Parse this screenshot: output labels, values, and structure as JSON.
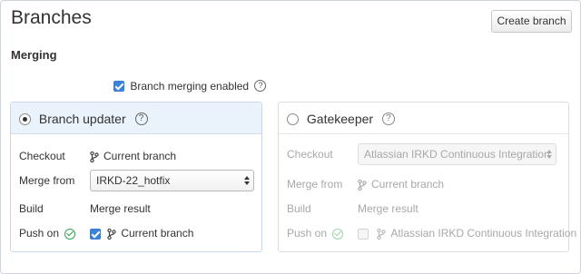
{
  "page": {
    "title": "Branches",
    "create_button": "Create branch"
  },
  "merging": {
    "section_title": "Merging",
    "enabled_label": "Branch merging enabled",
    "help_glyph": "?"
  },
  "branch_updater": {
    "title": "Branch updater",
    "selected": true,
    "checkout_label": "Checkout",
    "checkout_value": "Current branch",
    "merge_from_label": "Merge from",
    "merge_from_value": "IRKD-22_hotfix",
    "build_label": "Build",
    "build_value": "Merge result",
    "push_on_label": "Push on",
    "push_on_value": "Current branch"
  },
  "gatekeeper": {
    "title": "Gatekeeper",
    "selected": false,
    "checkout_label": "Checkout",
    "checkout_value": "Atlassian IRKD Continuous Integration",
    "merge_from_label": "Merge from",
    "merge_from_value": "Current branch",
    "build_label": "Build",
    "build_value": "Merge result",
    "push_on_label": "Push on",
    "push_on_value": "Atlassian IRKD Continuous Integration"
  },
  "icons": {
    "help": "help-icon",
    "branch": "branch-icon",
    "success": "check-circle-icon",
    "select_arrows": "updown-arrows-icon"
  },
  "colors": {
    "panel_active_header": "#eaf2fb",
    "success_green": "#2ea44f",
    "checkbox_blue": "#3b82d9",
    "disabled_text": "#a8a8a8"
  }
}
